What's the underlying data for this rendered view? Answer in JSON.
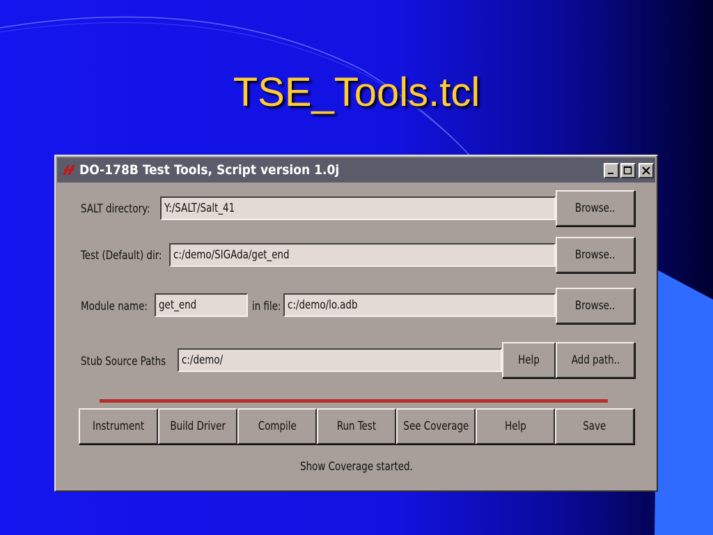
{
  "slide": {
    "title": "TSE_Tools.tcl",
    "title_color": "#ffcc33",
    "background_color": "#1414ee"
  },
  "window": {
    "title": "DO-178B Test Tools, Script version 1.0j",
    "icon": "tk-feather-icon",
    "controls": [
      "minimize-icon",
      "maximize-icon",
      "close-icon"
    ],
    "background_color": "#a99f9a",
    "titlebar_color": "#5a5c6a"
  },
  "form": {
    "salt_label": "SALT directory:",
    "salt_value": "Y:/SALT/Salt_41",
    "test_label": "Test (Default) dir:",
    "test_value": "c:/demo/SIGAda/get_end",
    "module_label": "Module name:",
    "module_value": "get_end",
    "infile_label": "in file:",
    "infile_value": "c:/demo/lo.adb",
    "stub_label": "Stub Source Paths",
    "stub_value": "c:/demo/",
    "browse_label": "Browse..",
    "help_label": "Help",
    "add_path_label": "Add path.."
  },
  "toolbar": {
    "buttons": [
      "Instrument",
      "Build Driver",
      "Compile",
      "Run Test",
      "See Coverage",
      "Help",
      "Save"
    ],
    "separator_color": "#b6302e"
  },
  "status": {
    "text": "Show Coverage started."
  }
}
